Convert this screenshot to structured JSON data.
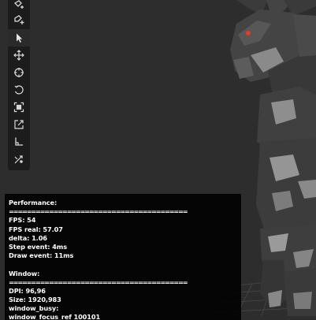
{
  "toolbar": {
    "tools": [
      {
        "icon": "add-point-icon",
        "active": false
      },
      {
        "icon": "add-shape-icon",
        "active": false
      },
      {
        "icon": "select-cursor-icon",
        "active": true
      },
      {
        "icon": "move-icon",
        "active": false
      },
      {
        "icon": "target-icon",
        "active": false
      },
      {
        "icon": "rotate-icon",
        "active": false
      },
      {
        "icon": "scale-icon",
        "active": false
      },
      {
        "icon": "export-icon",
        "active": false
      },
      {
        "icon": "bone-icon",
        "active": false
      },
      {
        "icon": "random-icon",
        "active": false
      }
    ]
  },
  "debug": {
    "performance_title": "Performance:",
    "separator": "========================================",
    "fps": "FPS: 54",
    "fps_real": "FPS real: 57.07",
    "delta": "delta: 1.06",
    "step_event": "Step event: 4ms",
    "draw_event": "Draw event: 11ms",
    "window_title": "Window:",
    "window_separator": "========================================",
    "dpi": "DPI: 96,96",
    "size": "Size: 1920,983",
    "window_busy": "window_busy:",
    "window_focus": "window_focus_ref 100101"
  },
  "colors": {
    "background": "#2d2d2d",
    "toolbar": "#1c1c1c",
    "icon": "#d8d8d8",
    "panel": "#000000",
    "model_dark": "#3a3a3a",
    "model_light": "#8e8e8e",
    "eye": "#e0401f"
  }
}
